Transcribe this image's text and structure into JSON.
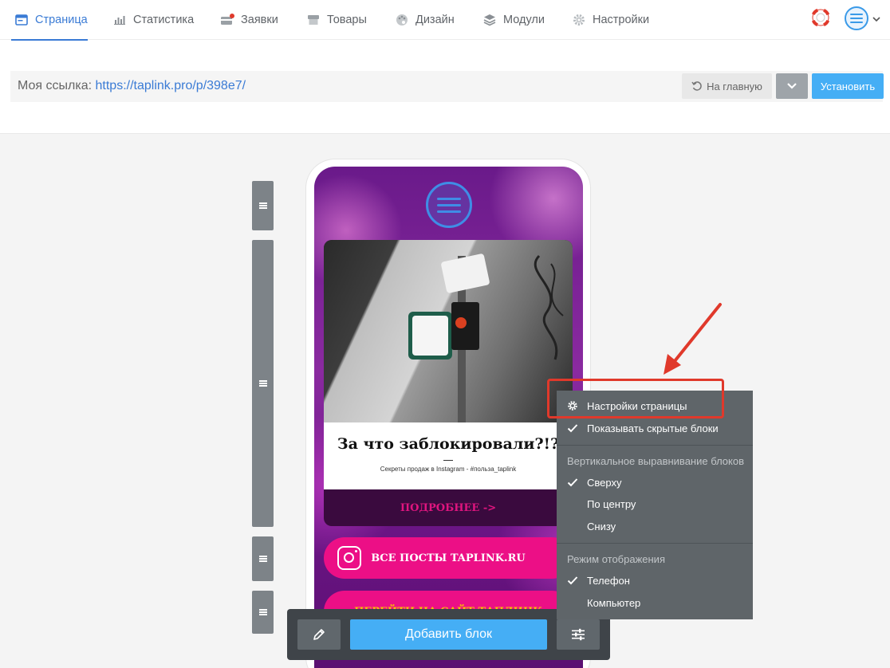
{
  "nav": {
    "tabs": [
      {
        "label": "Страница",
        "icon": "page-icon",
        "active": true
      },
      {
        "label": "Статистика",
        "icon": "stats-icon"
      },
      {
        "label": "Заявки",
        "icon": "orders-icon"
      },
      {
        "label": "Товары",
        "icon": "products-icon"
      },
      {
        "label": "Дизайн",
        "icon": "palette-icon"
      },
      {
        "label": "Модули",
        "icon": "modules-icon"
      },
      {
        "label": "Настройки",
        "icon": "gear-icon"
      }
    ],
    "accent": "#3a7bd5"
  },
  "linkbar": {
    "label": "Моя ссылка:",
    "url": "https://taplink.pro/p/398e7/",
    "home_button": "На главную",
    "install_button": "Установить"
  },
  "phone": {
    "card": {
      "title": "За что заблокировали?!?",
      "subtitle": "Секреты продаж в Instagram - #польза_taplink",
      "more_link": "ПОДРОБНЕЕ ->"
    },
    "buttons": [
      {
        "label": "ВСЕ ПОСТЫ TAPLINK.RU",
        "icon": "instagram-icon"
      },
      {
        "label": "ПЕРЕЙТИ НА САЙТ ТАПЛИНК"
      }
    ]
  },
  "toolbar": {
    "add_block": "Добавить блок",
    "colors": {
      "add": "#45aef5",
      "bg": "#3f4449"
    }
  },
  "menu": {
    "page_settings": "Настройки страницы",
    "show_hidden": "Показывать скрытые блоки",
    "valign_header": "Вертикальное выравнивание блоков",
    "valign_top": "Сверху",
    "valign_center": "По центру",
    "valign_bottom": "Снизу",
    "mode_header": "Режим отображения",
    "mode_phone": "Телефон",
    "mode_desktop": "Компьютер",
    "checked": [
      "show_hidden",
      "valign_top",
      "mode_phone"
    ]
  },
  "annotation": {
    "color": "#e0392b"
  }
}
